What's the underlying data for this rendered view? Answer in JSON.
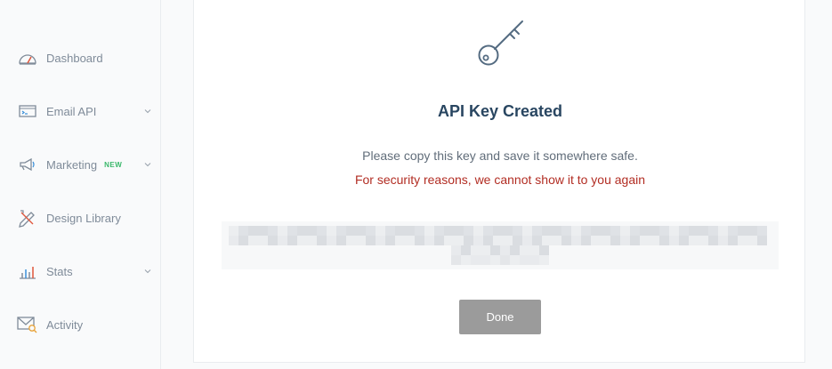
{
  "sidebar": {
    "items": [
      {
        "label": "Dashboard",
        "icon": "speedometer-icon"
      },
      {
        "label": "Email API",
        "icon": "terminal-window-icon",
        "has_chevron": true
      },
      {
        "label": "Marketing",
        "icon": "megaphone-icon",
        "badge": "NEW",
        "has_chevron": true
      },
      {
        "label": "Design Library",
        "icon": "pencil-ruler-icon"
      },
      {
        "label": "Stats",
        "icon": "bar-chart-icon",
        "has_chevron": true
      },
      {
        "label": "Activity",
        "icon": "envelope-search-icon"
      }
    ]
  },
  "modal": {
    "icon": "key-icon",
    "title": "API Key Created",
    "message": "Please copy this key and save it somewhere safe.",
    "warning": "For security reasons, we cannot show it to you again",
    "api_key_obscured": true,
    "done_label": "Done"
  },
  "colors": {
    "title": "#294661",
    "warning": "#b22d23",
    "badge_new": "#3bb86b",
    "done_button": "#9b9b9b",
    "sidebar_text": "#7f8b99"
  }
}
